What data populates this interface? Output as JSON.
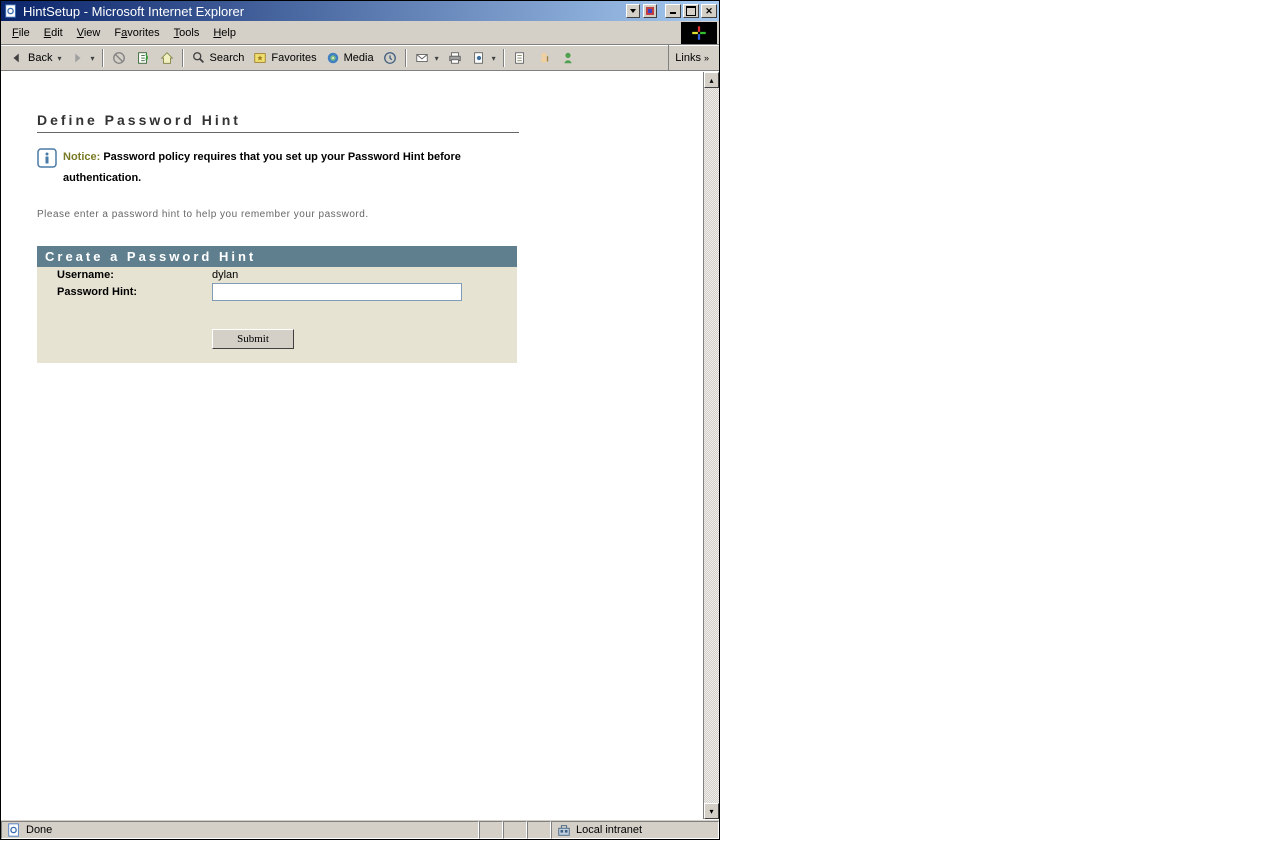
{
  "window": {
    "title": "HintSetup - Microsoft Internet Explorer"
  },
  "menubar": {
    "file": "File",
    "edit": "Edit",
    "view": "View",
    "favorites": "Favorites",
    "tools": "Tools",
    "help": "Help"
  },
  "toolbar": {
    "back": "Back",
    "search": "Search",
    "favorites": "Favorites",
    "media": "Media",
    "links": "Links"
  },
  "page": {
    "heading": "Define Password Hint",
    "notice_label": "Notice:",
    "notice_text": "Password policy requires that you set up your Password Hint before authentication.",
    "instruction": "Please enter a password hint to help you remember your password.",
    "panel_header": "Create a Password Hint",
    "username_label": "Username:",
    "username_value": "dylan",
    "hint_label": "Password Hint:",
    "hint_value": "",
    "submit_label": "Submit"
  },
  "status": {
    "done": "Done",
    "zone": "Local intranet"
  }
}
